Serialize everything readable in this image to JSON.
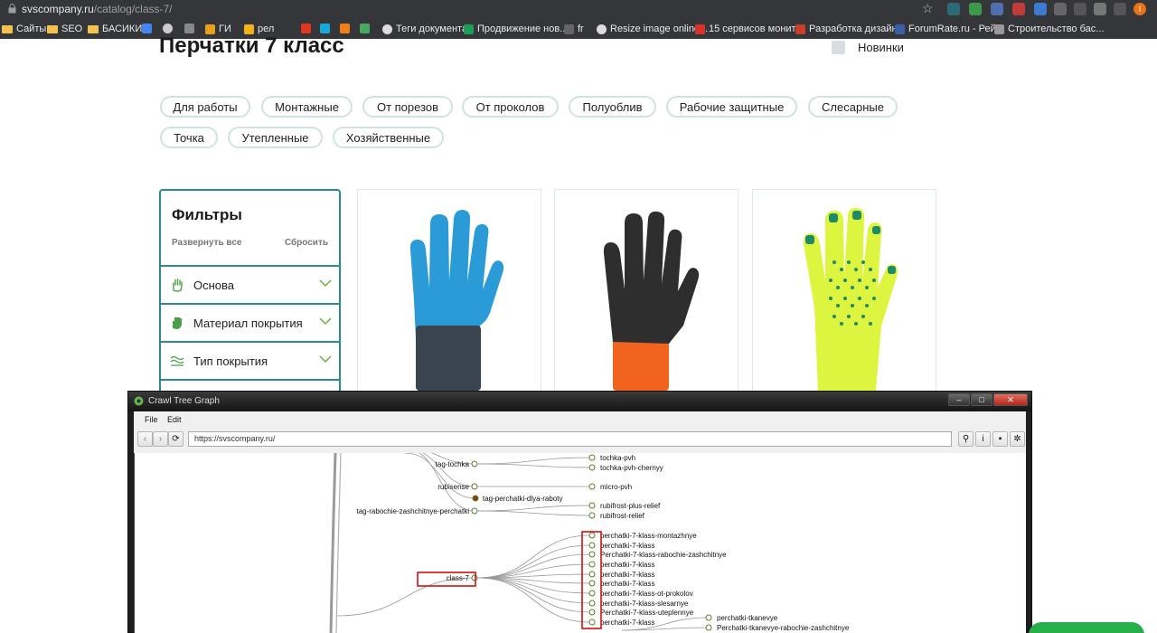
{
  "browser": {
    "url_domain": "svscompany.ru",
    "url_path": "/catalog/class-7/",
    "profile_initial": "I",
    "bookmarks": [
      {
        "label": "Сайты",
        "icon": "folder-icon"
      },
      {
        "label": "SEO",
        "icon": "folder-icon"
      },
      {
        "label": "БАСИКИ",
        "icon": "folder-icon"
      },
      {
        "label": "",
        "icon": "google-icon"
      },
      {
        "label": "",
        "icon": "globe-icon"
      },
      {
        "label": "",
        "icon": "signal-icon"
      },
      {
        "label": "ГИ",
        "icon": "signal-icon"
      },
      {
        "label": "рел",
        "icon": "ahrefs-icon"
      },
      {
        "label": "",
        "icon": "spark-icon"
      },
      {
        "label": "",
        "icon": "e-icon"
      },
      {
        "label": "",
        "icon": "bolt-icon"
      },
      {
        "label": "",
        "icon": "check-icon"
      },
      {
        "label": "Теги документа",
        "icon": "globe-icon"
      },
      {
        "label": "Продвижение нов...",
        "icon": "r-icon"
      },
      {
        "label": "fr",
        "icon": "plus-icon"
      },
      {
        "label": "Resize image online...",
        "icon": "globe-icon"
      },
      {
        "label": "15 сервисов монит...",
        "icon": "ips-icon"
      },
      {
        "label": "Разработка дизайн...",
        "icon": "pin-icon"
      },
      {
        "label": "ForumRate.ru - Рей...",
        "icon": "fr-icon"
      },
      {
        "label": "Строительство бас...",
        "icon": "logo-icon"
      }
    ]
  },
  "page": {
    "title": "Перчатки 7 класс",
    "novinki_label": "Новинки",
    "tags": [
      "Для работы",
      "Монтажные",
      "От порезов",
      "От проколов",
      "Полуоблив",
      "Рабочие защитные",
      "Слесарные",
      "Точка",
      "Утепленные",
      "Хозяйственные"
    ],
    "filters": {
      "title": "Фильтры",
      "expand_all": "Развернуть все",
      "reset": "Сбросить",
      "rows": [
        {
          "label": "Основа",
          "icon": "hand-icon"
        },
        {
          "label": "Материал покрытия",
          "icon": "hand-filled-icon"
        },
        {
          "label": "Тип покрытия",
          "icon": "waves-icon"
        }
      ]
    },
    "products": [
      {
        "name": "blue-glove",
        "palm_color": "#2a9bd6",
        "cuff_color": "#3a4450"
      },
      {
        "name": "black-orange-glove",
        "palm_color": "#2e2e2e",
        "cuff_color": "#f0641e"
      },
      {
        "name": "yellow-dotted-glove",
        "palm_color": "#ddf53f",
        "cuff_color": "#ddf53f"
      }
    ]
  },
  "crawl_window": {
    "title": "Crawl Tree Graph",
    "menu": [
      "File",
      "Edit"
    ],
    "address": "https://svscompany.ru/",
    "tree": {
      "top_parents": [
        "tag-tochka",
        "rubisense",
        "tag-rabochie-zashchitnye-perchatki"
      ],
      "top_children": [
        "tochka-pvh",
        "tochka-pvh-chernyy",
        "micro-pvh",
        "tag-perchatki-dlya-raboty",
        "rubifrost-plus-relief",
        "rubifrost-relief"
      ],
      "focus_node": "class-7",
      "class7_children": [
        "perchatki-7-klass-montazhnye",
        "perchatki-7-klass",
        "Perchatki-7-klass-rabochie-zashchitnye",
        "perchatki-7-klass",
        "perchatki-7-klass",
        "perchatki-7-klass",
        "perchatki-7-klass-ot-prokolov",
        "perchatki-7-klass-slesarnye",
        "Perchatki-7-klass-uteplennye",
        "perchatki-7-klass"
      ],
      "leaf_nodes": [
        "perchatki-tkanevye",
        "Perchatki-tkanevye-rabochie-zashchitnye"
      ]
    }
  }
}
